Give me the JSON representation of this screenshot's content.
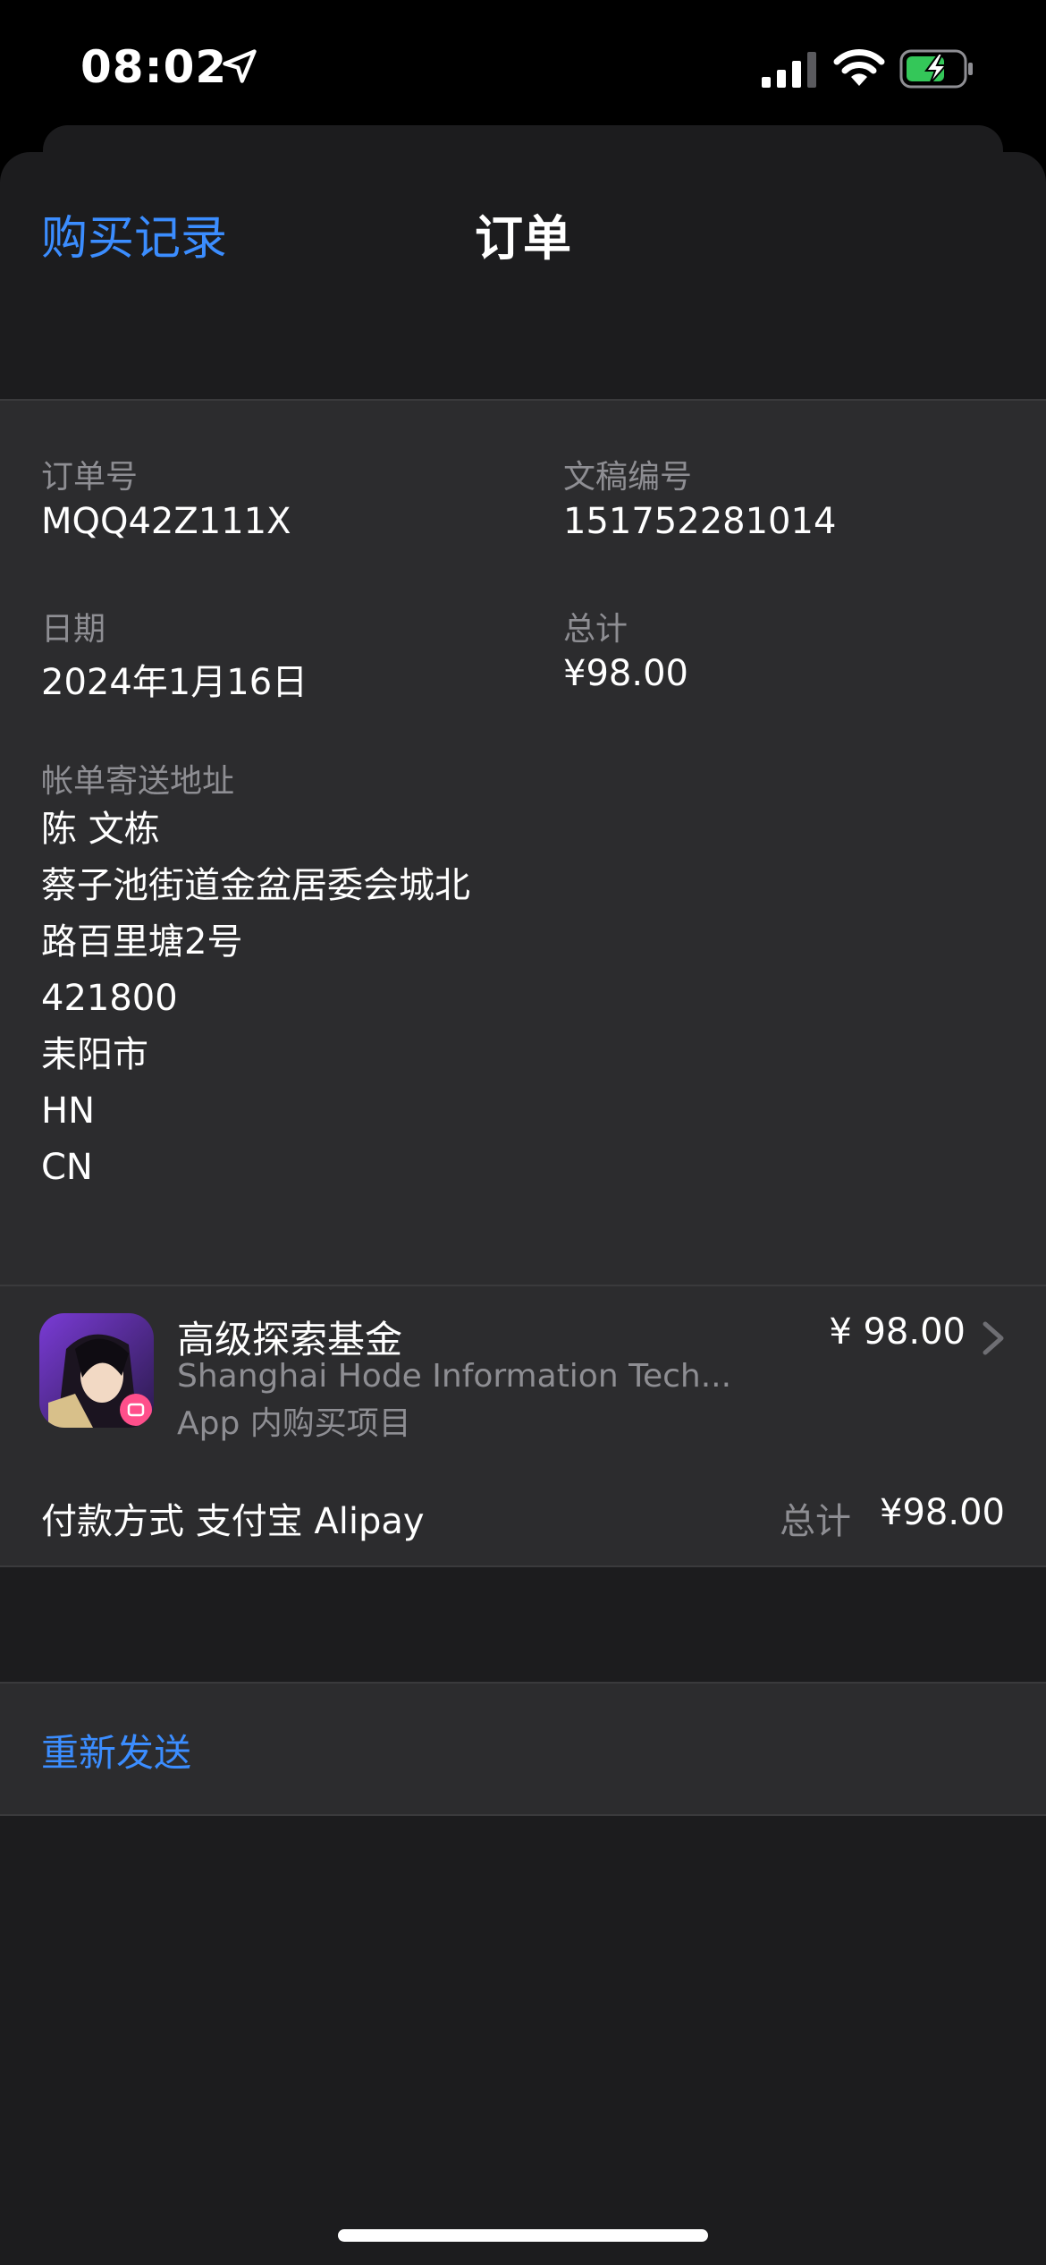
{
  "status_bar": {
    "time": "08:02"
  },
  "nav": {
    "back_label": "购买记录",
    "title": "订单"
  },
  "order": {
    "order_no_label": "订单号",
    "order_no": "MQQ42Z111X",
    "doc_no_label": "文稿编号",
    "doc_no": "151752281014",
    "date_label": "日期",
    "date": "2024年1月16日",
    "total_label": "总计",
    "total": "¥98.00",
    "billing_label": "帐单寄送地址",
    "billing_lines": [
      "陈 文栋",
      "蔡子池街道金盆居委会城北",
      "路百里塘2号",
      "421800",
      "耒阳市",
      "HN",
      "CN"
    ]
  },
  "item": {
    "title": "高级探索基金",
    "developer": "Shanghai Hode Information Tech...",
    "type": "App 内购买项目",
    "price": "¥ 98.00"
  },
  "payment": {
    "label": "付款方式 支付宝 Alipay",
    "total_label": "总计",
    "total": "¥98.00"
  },
  "actions": {
    "resend": "重新发送"
  }
}
